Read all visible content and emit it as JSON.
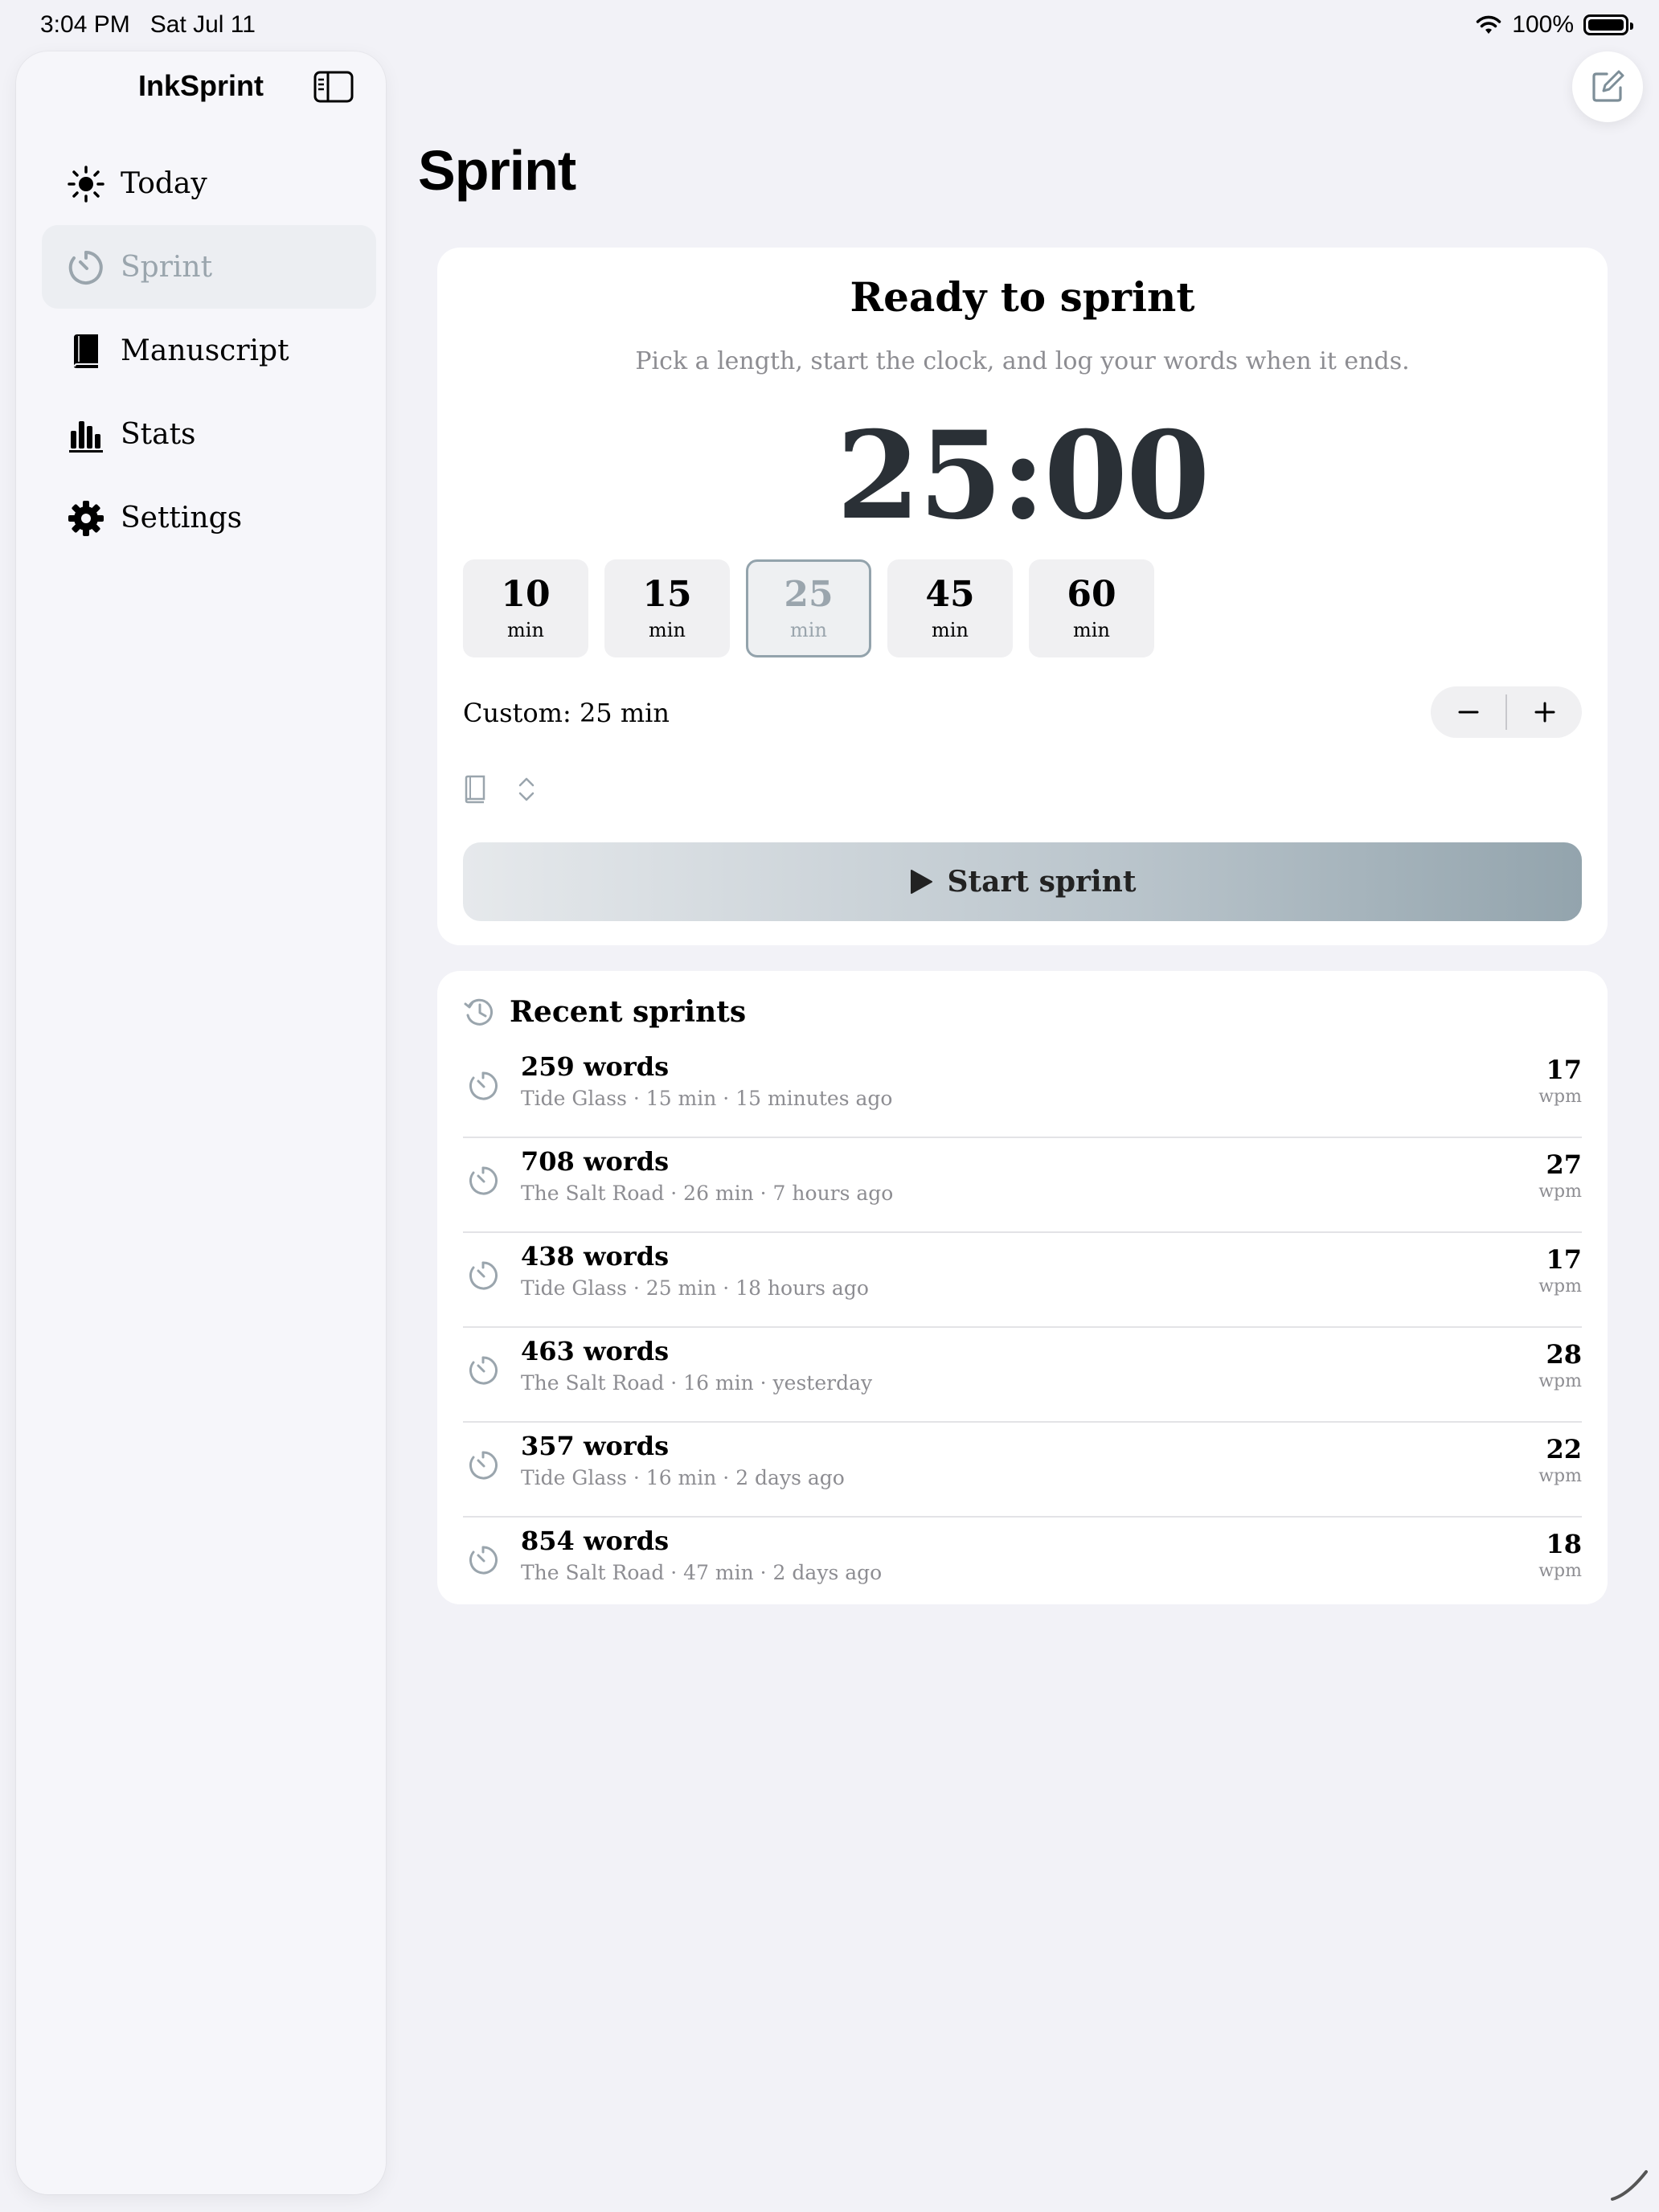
{
  "status_bar": {
    "time": "3:04 PM",
    "date": "Sat Jul 11",
    "battery": "100%"
  },
  "sidebar": {
    "title": "InkSprint",
    "items": [
      {
        "label": "Today",
        "icon": "sun-icon",
        "active": false
      },
      {
        "label": "Sprint",
        "icon": "timer-icon",
        "active": true
      },
      {
        "label": "Manuscript",
        "icon": "book-icon",
        "active": false
      },
      {
        "label": "Stats",
        "icon": "bar-chart-icon",
        "active": false
      },
      {
        "label": "Settings",
        "icon": "gear-icon",
        "active": false
      }
    ]
  },
  "page": {
    "title": "Sprint"
  },
  "sprint": {
    "heading": "Ready to sprint",
    "subtitle": "Pick a length, start the clock, and log your words when it ends.",
    "timer": "25:00",
    "presets": [
      {
        "value": "10",
        "unit": "min"
      },
      {
        "value": "15",
        "unit": "min"
      },
      {
        "value": "25",
        "unit": "min",
        "selected": true
      },
      {
        "value": "45",
        "unit": "min"
      },
      {
        "value": "60",
        "unit": "min"
      }
    ],
    "custom_label": "Custom: 25 min",
    "start_label": "Start sprint"
  },
  "recent": {
    "heading": "Recent sprints",
    "rows": [
      {
        "words": "259 words",
        "meta": "Tide Glass · 15 min · 15 minutes ago",
        "wpm": "17",
        "unit": "wpm"
      },
      {
        "words": "708 words",
        "meta": "The Salt Road · 26 min · 7 hours ago",
        "wpm": "27",
        "unit": "wpm"
      },
      {
        "words": "438 words",
        "meta": "Tide Glass · 25 min · 18 hours ago",
        "wpm": "17",
        "unit": "wpm"
      },
      {
        "words": "463 words",
        "meta": "The Salt Road · 16 min · yesterday",
        "wpm": "28",
        "unit": "wpm"
      },
      {
        "words": "357 words",
        "meta": "Tide Glass · 16 min · 2 days ago",
        "wpm": "22",
        "unit": "wpm"
      },
      {
        "words": "854 words",
        "meta": "The Salt Road · 47 min · 2 days ago",
        "wpm": "18",
        "unit": "wpm"
      }
    ]
  },
  "colors": {
    "accent": "#93a4ad",
    "timer": "#2a3036",
    "muted": "#8d8d92"
  }
}
